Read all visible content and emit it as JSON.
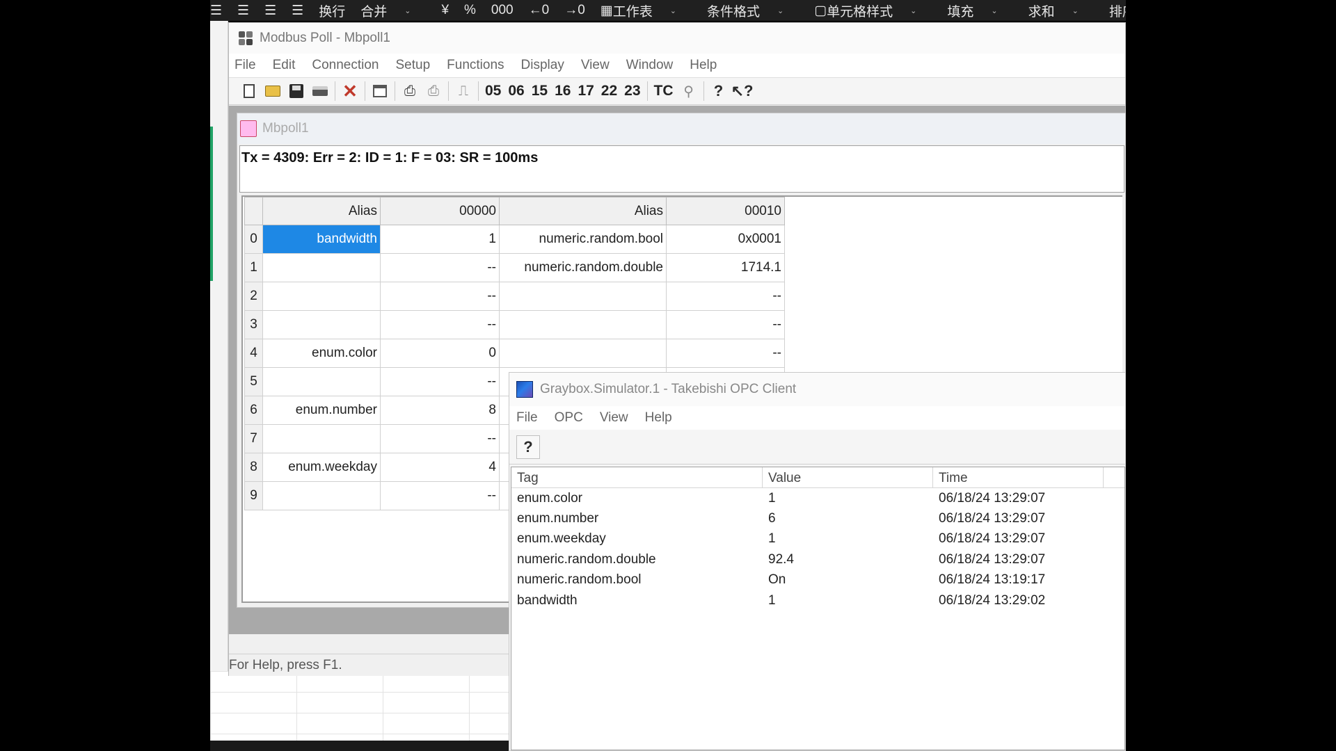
{
  "excel_ribbon": {
    "items": [
      {
        "label": "换行"
      },
      {
        "label": "合并",
        "chevron": "⌄"
      },
      {
        "label": "%"
      },
      {
        "label": "工作表",
        "chevron": "⌄"
      },
      {
        "label": "条件格式",
        "chevron": "⌄"
      },
      {
        "label": "单元格样式",
        "chevron": "⌄"
      },
      {
        "label": "填充",
        "chevron": "⌄"
      },
      {
        "label": "求和",
        "chevron": "⌄"
      },
      {
        "label": "排序"
      }
    ]
  },
  "modbus_poll": {
    "title": "Modbus Poll - Mbpoll1",
    "menu": [
      "File",
      "Edit",
      "Connection",
      "Setup",
      "Functions",
      "Display",
      "View",
      "Window",
      "Help"
    ],
    "toolbar_codes": [
      "05",
      "06",
      "15",
      "16",
      "17",
      "22",
      "23",
      "TC"
    ],
    "status_bar": "For Help, press F1."
  },
  "mbpoll1": {
    "title": "Mbpoll1",
    "status_line": "Tx = 4309: Err = 2: ID = 1: F = 03: SR = 100ms",
    "headers": {
      "alias1": "Alias",
      "col1": "00000",
      "alias2": "Alias",
      "col2": "00010"
    },
    "rows": [
      {
        "idx": "0",
        "alias1": "bandwidth",
        "val1": "1",
        "alias2": "numeric.random.bool",
        "val2": "0x0001"
      },
      {
        "idx": "1",
        "alias1": "",
        "val1": "--",
        "alias2": "numeric.random.double",
        "val2": "1714.1"
      },
      {
        "idx": "2",
        "alias1": "",
        "val1": "--",
        "alias2": "",
        "val2": "--"
      },
      {
        "idx": "3",
        "alias1": "",
        "val1": "--",
        "alias2": "",
        "val2": "--"
      },
      {
        "idx": "4",
        "alias1": "enum.color",
        "val1": "0",
        "alias2": "",
        "val2": "--"
      },
      {
        "idx": "5",
        "alias1": "",
        "val1": "--",
        "alias2": "",
        "val2": ""
      },
      {
        "idx": "6",
        "alias1": "enum.number",
        "val1": "8",
        "alias2": "",
        "val2": ""
      },
      {
        "idx": "7",
        "alias1": "",
        "val1": "--",
        "alias2": "",
        "val2": ""
      },
      {
        "idx": "8",
        "alias1": "enum.weekday",
        "val1": "4",
        "alias2": "",
        "val2": ""
      },
      {
        "idx": "9",
        "alias1": "",
        "val1": "--",
        "alias2": "",
        "val2": ""
      }
    ]
  },
  "opc_client": {
    "title": "Graybox.Simulator.1 - Takebishi OPC Client",
    "menu": [
      "File",
      "OPC",
      "View",
      "Help"
    ],
    "columns": {
      "tag": "Tag",
      "value": "Value",
      "time": "Time"
    },
    "rows": [
      {
        "tag": "enum.color",
        "value": "1",
        "time": "06/18/24 13:29:07"
      },
      {
        "tag": "enum.number",
        "value": "6",
        "time": "06/18/24 13:29:07"
      },
      {
        "tag": "enum.weekday",
        "value": "1",
        "time": "06/18/24 13:29:07"
      },
      {
        "tag": "numeric.random.double",
        "value": "92.4",
        "time": "06/18/24 13:29:07"
      },
      {
        "tag": "numeric.random.bool",
        "value": "On",
        "time": "06/18/24 13:19:17"
      },
      {
        "tag": "bandwidth",
        "value": "1",
        "time": "06/18/24 13:29:02"
      }
    ]
  }
}
